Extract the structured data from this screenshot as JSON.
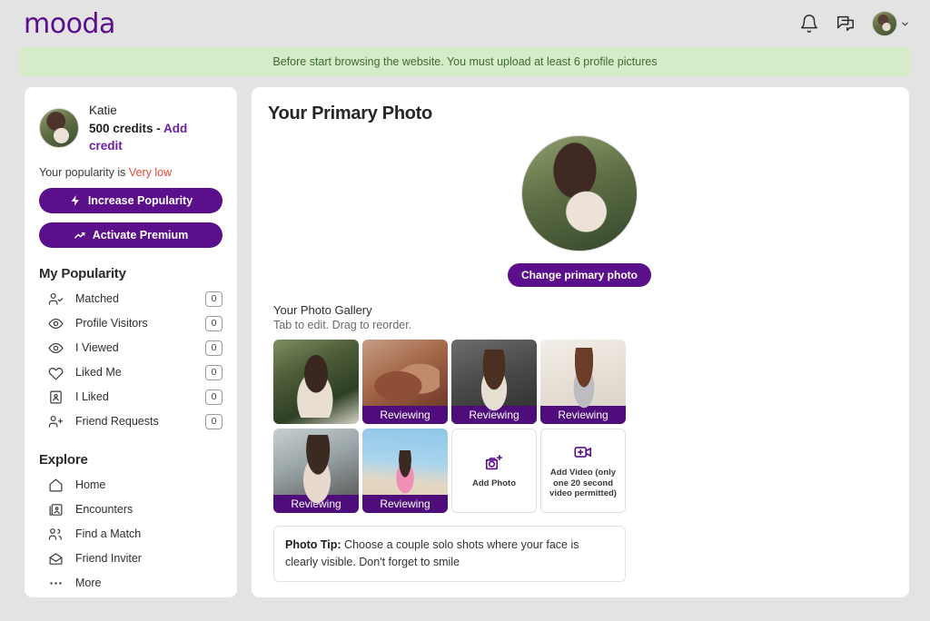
{
  "header": {
    "logo": "mooda",
    "icons": [
      "bell-icon",
      "chat-icon"
    ],
    "avatar_alt": "user-avatar"
  },
  "alert": {
    "message": "Before start browsing the website. You must upload at least 6 profile pictures",
    "bg_color": "#d6ecc8",
    "text_color": "#3e6b35"
  },
  "sidebar": {
    "profile": {
      "name": "Katie",
      "credits": "500 credits",
      "separator": " - ",
      "add_credit": "Add credit"
    },
    "popularity": {
      "prefix": "Your popularity is ",
      "value": "Very low",
      "value_color": "#e24a3a"
    },
    "buttons": [
      {
        "label": "Increase Popularity",
        "icon": "bolt-icon"
      },
      {
        "label": "Activate Premium",
        "icon": "trending-up-icon"
      }
    ],
    "popularity_section": {
      "title": "My Popularity",
      "items": [
        {
          "label": "Matched",
          "count": "0",
          "icon": "user-check-icon"
        },
        {
          "label": "Profile Visitors",
          "count": "0",
          "icon": "eye-icon"
        },
        {
          "label": "I Viewed",
          "count": "0",
          "icon": "eye-icon"
        },
        {
          "label": "Liked Me",
          "count": "0",
          "icon": "heart-icon"
        },
        {
          "label": "I Liked",
          "count": "0",
          "icon": "id-card-icon"
        },
        {
          "label": "Friend Requests",
          "count": "0",
          "icon": "user-plus-icon"
        }
      ]
    },
    "explore_section": {
      "title": "Explore",
      "items": [
        {
          "label": "Home",
          "icon": "home-icon"
        },
        {
          "label": "Encounters",
          "icon": "image-card-icon"
        },
        {
          "label": "Find a Match",
          "icon": "users-icon"
        },
        {
          "label": "Friend Inviter",
          "icon": "envelope-open-icon"
        },
        {
          "label": "More",
          "icon": "ellipsis-icon"
        }
      ]
    }
  },
  "main": {
    "title": "Your Primary Photo",
    "change_button": "Change primary photo",
    "gallery": {
      "title": "Your Photo Gallery",
      "subtitle": "Tab to edit. Drag to reorder.",
      "tiles": [
        {
          "type": "photo",
          "status": "",
          "photo_class": "ph1"
        },
        {
          "type": "photo",
          "status": "Reviewing",
          "photo_class": "ph2"
        },
        {
          "type": "photo",
          "status": "Reviewing",
          "photo_class": "ph3"
        },
        {
          "type": "photo",
          "status": "Reviewing",
          "photo_class": "ph4"
        },
        {
          "type": "photo",
          "status": "Reviewing",
          "photo_class": "ph5"
        },
        {
          "type": "photo",
          "status": "Reviewing",
          "photo_class": "ph6"
        }
      ],
      "add_photo": {
        "label": "Add Photo",
        "icon": "camera-plus-icon"
      },
      "add_video": {
        "label": "Add Video (only one 20 second video permitted)",
        "icon": "video-plus-icon"
      }
    },
    "tip": {
      "label": "Photo Tip:",
      "text": " Choose a couple solo shots where your face is clearly visible. Don't forget to smile"
    }
  },
  "theme": {
    "accent": "#5b0f8b",
    "page_bg": "#e3e3e3",
    "card_bg": "#ffffff"
  }
}
